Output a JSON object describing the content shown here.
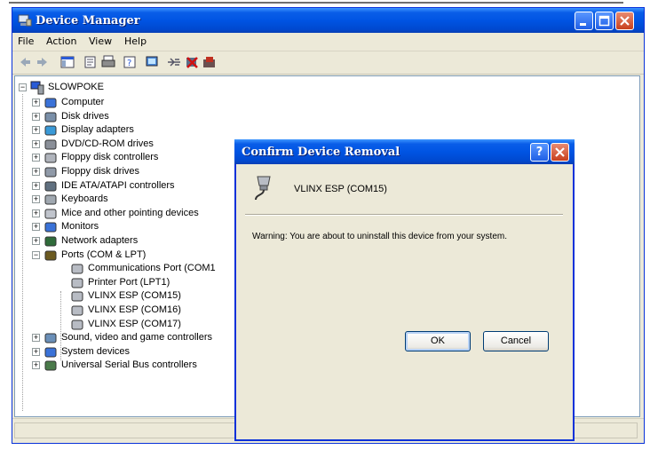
{
  "window": {
    "title": "Device Manager"
  },
  "menu": [
    "File",
    "Action",
    "View",
    "Help"
  ],
  "tree": {
    "root": "SLOWPOKE",
    "categories": [
      "Computer",
      "Disk drives",
      "Display adapters",
      "DVD/CD-ROM drives",
      "Floppy disk controllers",
      "Floppy disk drives",
      "IDE ATA/ATAPI controllers",
      "Keyboards",
      "Mice and other pointing devices",
      "Monitors",
      "Network adapters",
      "Ports (COM & LPT)"
    ],
    "ports_children": [
      "Communications Port (COM1",
      "Printer Port (LPT1)",
      "VLINX ESP (COM15)",
      "VLINX ESP (COM16)",
      "VLINX ESP (COM17)"
    ],
    "after_ports": [
      "Sound, video and game controllers",
      "System devices",
      "Universal Serial Bus controllers"
    ]
  },
  "dialog": {
    "title": "Confirm Device Removal",
    "help_glyph": "?",
    "device_name": "VLINX ESP (COM15)",
    "warning": "Warning: You are about to uninstall this device from your system.",
    "ok_label": "OK",
    "cancel_label": "Cancel"
  },
  "colors": {
    "titlebar": "#0054e3",
    "window_face": "#ece9d8",
    "close_button": "#c8401d"
  }
}
